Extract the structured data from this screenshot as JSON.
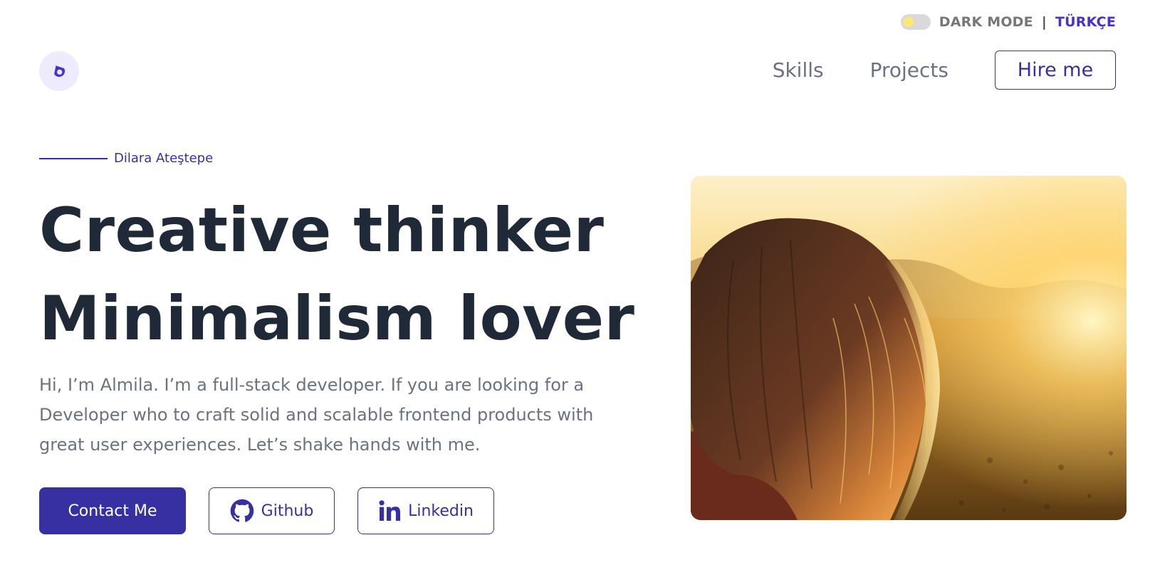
{
  "topbar": {
    "dark_mode_label": "DARK MODE",
    "separator": "|",
    "language": "TÜRKÇE"
  },
  "logo": {
    "icon": "logo-mark-icon",
    "color": "#4731d3"
  },
  "nav": {
    "items": [
      {
        "label": "Skills"
      },
      {
        "label": "Projects"
      }
    ],
    "hire_label": "Hire me"
  },
  "hero": {
    "eyebrow_name": "Dilara Ateştepe",
    "headline_line1": "Creative thinker",
    "headline_line2": "Minimalism lover",
    "intro": "Hi, I’m Almila. I’m a full-stack developer. If you are looking for a Developer who to craft solid and scalable frontend products with great user experiences. Let’s shake hands with me.",
    "buttons": {
      "contact": "Contact Me",
      "github": "Github",
      "linkedin": "Linkedin"
    },
    "image": {
      "icon": "portrait-photo"
    }
  },
  "colors": {
    "accent": "#3730a3",
    "headline": "#1f2937",
    "body_text": "#6b7280",
    "lang_link": "#4731d3"
  }
}
